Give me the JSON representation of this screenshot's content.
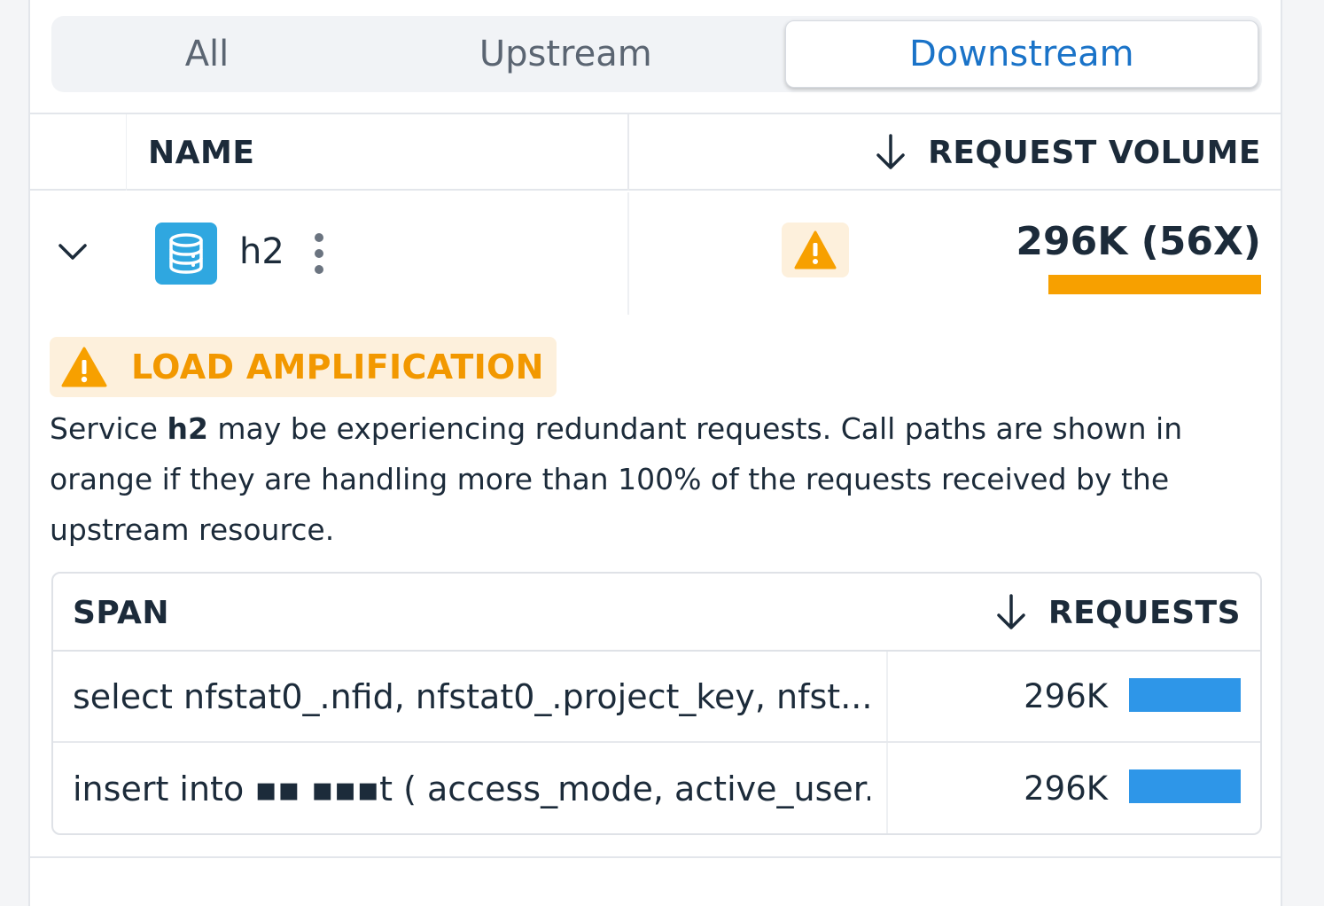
{
  "tabs": {
    "all": "All",
    "upstream": "Upstream",
    "downstream": "Downstream",
    "active": "downstream"
  },
  "table": {
    "col_name": "NAME",
    "col_volume": "REQUEST VOLUME",
    "sort_icon": "arrow-down-icon"
  },
  "row": {
    "expand_icon": "chevron-down-icon",
    "service_icon": "database-icon",
    "service_name": "h2",
    "menu_icon": "kebab-menu-icon",
    "warning_icon": "warning-icon",
    "volume": "296K (56X)",
    "volume_bar_fraction": 1.0,
    "volume_bar_color": "#f7a000"
  },
  "alert": {
    "icon": "warning-icon",
    "title": "LOAD AMPLIFICATION",
    "desc_prefix": "Service ",
    "desc_service": "h2",
    "desc_rest": " may be experiencing redundant requests. Call paths are shown in orange if they are handling more than 100% of the requests received by the upstream resource.",
    "color": "#f29800"
  },
  "spans": {
    "col_span": "SPAN",
    "col_requests": "REQUESTS",
    "rows": [
      {
        "span": "select nfstat0_.nfid, nfstat0_.project_key, nfst...",
        "requests": "296K",
        "bar_fraction": 1.0
      },
      {
        "span": "insert into ▪▪ ▪▪▪t ( access_mode, active_user...",
        "requests": "296K",
        "bar_fraction": 1.0
      }
    ],
    "bar_color": "#2e96e8"
  }
}
